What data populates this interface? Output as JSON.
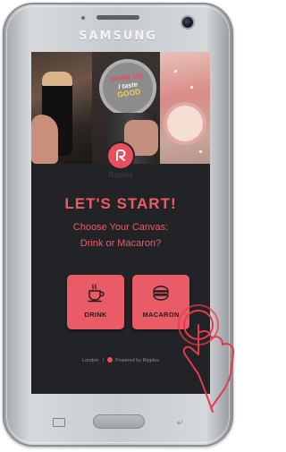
{
  "device": {
    "brand": "SAMSUNG"
  },
  "hero": {
    "coaster_line1": "DRINK ME",
    "coaster_line2": "I taste",
    "coaster_line3": "GOOD"
  },
  "app": {
    "name": "Ripples"
  },
  "start": {
    "title": "LET'S START!",
    "subtitle_line1": "Choose Your Canvas:",
    "subtitle_line2": "Drink or Macaron?"
  },
  "buttons": {
    "drink_label": "DRINK",
    "drink_icon": "coffee-cup-icon",
    "macaron_label": "MACARON",
    "macaron_icon": "macaron-icon"
  },
  "footer": {
    "location": "London",
    "separator": "|",
    "powered_by": "Powered by Ripples"
  },
  "colors": {
    "accent": "#ef5a66",
    "button": "#e95c67",
    "screen_bg": "#222327",
    "pointer": "#e63a4a"
  }
}
